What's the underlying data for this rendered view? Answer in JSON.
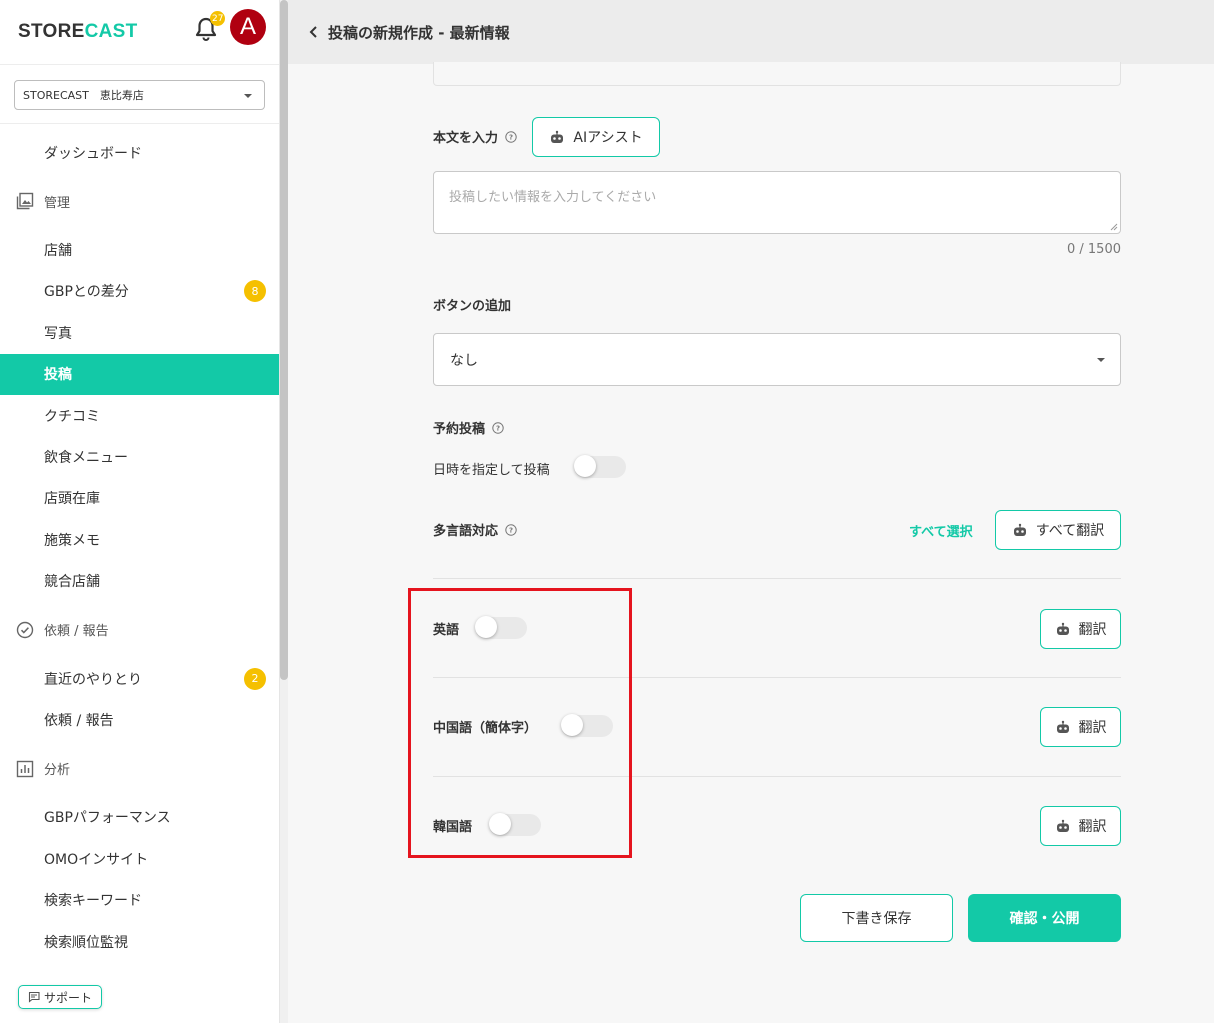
{
  "app": {
    "logo_part1": "STORE",
    "logo_part2": "CAST",
    "notification_count": "27",
    "avatar_letter": "A"
  },
  "store_selector": {
    "value": "STORECAST　恵比寿店"
  },
  "sidebar": {
    "dashboard": "ダッシュボード",
    "section_manage": "管理",
    "manage_items": [
      "店舗",
      "GBPとの差分",
      "写真",
      "投稿",
      "クチコミ",
      "飲食メニュー",
      "店頭在庫",
      "施策メモ",
      "競合店舗"
    ],
    "gbp_diff_badge": "8",
    "section_request": "依頼 / 報告",
    "request_items": [
      "直近のやりとり",
      "依頼 / 報告"
    ],
    "recent_badge": "2",
    "section_analysis": "分析",
    "analysis_items": [
      "GBPパフォーマンス",
      "OMOインサイト",
      "検索キーワード",
      "検索順位監視"
    ],
    "active_item": "投稿",
    "support_label": "サポート"
  },
  "header": {
    "title": "投稿の新規作成 - 最新情報"
  },
  "form": {
    "body_label": "本文を入力",
    "ai_assist_label": "AIアシスト",
    "body_placeholder": "投稿したい情報を入力してください",
    "body_counter": "0 / 1500",
    "button_add_label": "ボタンの追加",
    "button_add_value": "なし",
    "scheduled_label": "予約投稿",
    "scheduled_toggle_label": "日時を指定して投稿",
    "multilang_label": "多言語対応",
    "select_all_label": "すべて選択",
    "translate_all_label": "すべて翻訳",
    "languages": [
      {
        "name": "英語",
        "translate": "翻訳"
      },
      {
        "name": "中国語（簡体字）",
        "translate": "翻訳"
      },
      {
        "name": "韓国語",
        "translate": "翻訳"
      }
    ],
    "save_draft_label": "下書き保存",
    "publish_label": "確認・公開"
  },
  "colors": {
    "accent": "#13c9a7",
    "badge": "#f5c000",
    "highlight": "#e5141e",
    "avatar": "#b00010"
  }
}
